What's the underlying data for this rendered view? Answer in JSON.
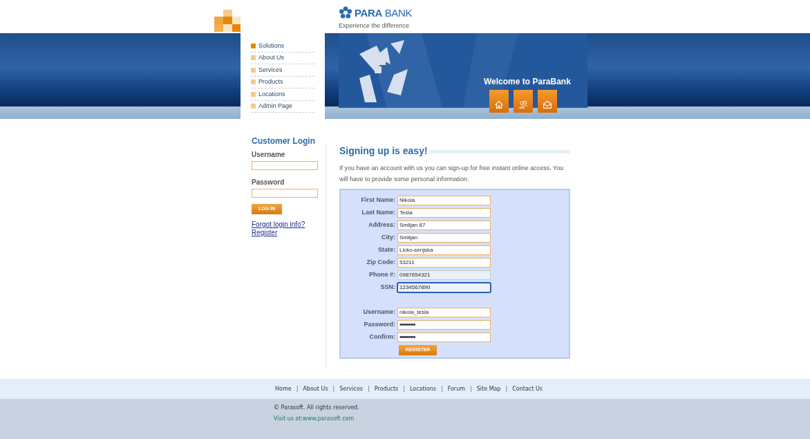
{
  "header": {
    "logo": "**PARA** BANK",
    "tagline": "Experience the difference"
  },
  "menu": [
    {
      "label": "Solutions",
      "selected": true
    },
    {
      "label": "About Us",
      "selected": false
    },
    {
      "label": "Services",
      "selected": false
    },
    {
      "label": "Products",
      "selected": false
    },
    {
      "label": "Locations",
      "selected": false
    },
    {
      "label": "Admin Page",
      "selected": false
    }
  ],
  "banner": {
    "welcome": "Welcome to ParaBank",
    "buttons": [
      {
        "kind": "home"
      },
      {
        "kind": "people"
      },
      {
        "kind": "mail"
      }
    ]
  },
  "login": {
    "title": "Customer Login",
    "username_label": "Username",
    "password_label": "Password",
    "button": "LOG IN",
    "links": [
      "Forgot login info?",
      "Register"
    ]
  },
  "signup": {
    "title": "Signing up is easy!",
    "intro": "If you have an account with us you can sign-up for free instant online access. You will have to provide some personal information.",
    "fields": [
      {
        "label": "First Name:",
        "value": "Nikola",
        "kind": "text",
        "autofilled": false,
        "focused": false
      },
      {
        "label": "Last Name:",
        "value": "Tesla",
        "kind": "text",
        "autofilled": false,
        "focused": false
      },
      {
        "label": "Address:",
        "value": "Smiljan 87",
        "kind": "text",
        "autofilled": false,
        "focused": false
      },
      {
        "label": "City:",
        "value": "Smiljan",
        "kind": "text",
        "autofilled": false,
        "focused": false
      },
      {
        "label": "State:",
        "value": "Licko-senjska",
        "kind": "text",
        "autofilled": false,
        "focused": false
      },
      {
        "label": "Zip Code:",
        "value": "53211",
        "kind": "text",
        "autofilled": false,
        "focused": false
      },
      {
        "label": "Phone #:",
        "value": "0987654321",
        "kind": "text",
        "autofilled": true,
        "focused": false
      },
      {
        "label": "SSN:",
        "value": "1234567890",
        "kind": "text",
        "autofilled": false,
        "focused": true
      },
      {
        "kind": "spacer"
      },
      {
        "label": "Username:",
        "value": "nikola_tesla",
        "kind": "text",
        "autofilled": false,
        "focused": false
      },
      {
        "label": "Password:",
        "value": "•••••••••",
        "kind": "password",
        "autofilled": false,
        "focused": false
      },
      {
        "label": "Confirm:",
        "value": "•••••••••",
        "kind": "password",
        "autofilled": false,
        "focused": false
      }
    ],
    "button": "REGISTER"
  },
  "footer": {
    "items": [
      {
        "kind": "link",
        "text": "Home"
      },
      {
        "kind": "separator",
        "text": "|"
      },
      {
        "kind": "link",
        "text": "About Us"
      },
      {
        "kind": "separator",
        "text": "|"
      },
      {
        "kind": "link",
        "text": "Services"
      },
      {
        "kind": "separator",
        "text": "|"
      },
      {
        "kind": "link",
        "text": "Products"
      },
      {
        "kind": "separator",
        "text": "|"
      },
      {
        "kind": "link",
        "text": "Locations"
      },
      {
        "kind": "separator",
        "text": "|"
      },
      {
        "kind": "link",
        "text": "Forum"
      },
      {
        "kind": "separator",
        "text": "|"
      },
      {
        "kind": "link",
        "text": "Site Map"
      },
      {
        "kind": "separator",
        "text": "|"
      },
      {
        "kind": "link",
        "text": "Contact Us"
      }
    ],
    "copyright": "© Parasoft. All rights reserved.",
    "visit": "Visit us at:www.parasoft.com"
  }
}
